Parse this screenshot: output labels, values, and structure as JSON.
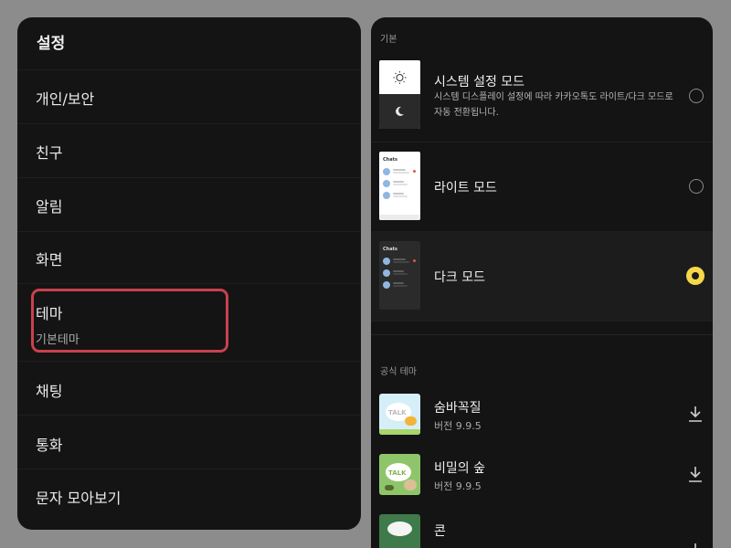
{
  "settings": {
    "title": "설정",
    "items": [
      {
        "label": "개인/보안"
      },
      {
        "label": "친구"
      },
      {
        "label": "알림"
      },
      {
        "label": "화면"
      },
      {
        "label": "테마",
        "sublabel": "기본테마"
      },
      {
        "label": "채팅"
      },
      {
        "label": "통화"
      },
      {
        "label": "문자 모아보기"
      }
    ]
  },
  "theme_page": {
    "basic_section_label": "기본",
    "modes": [
      {
        "title": "시스템 설정 모드",
        "description": "시스템 디스플레이 설정에 따라 카카오톡도 라이트/다크 모드로 자동 전환됩니다.",
        "selected": false
      },
      {
        "title": "라이트 모드",
        "thumb_caption": "Chats",
        "selected": false
      },
      {
        "title": "다크 모드",
        "thumb_caption": "Chats",
        "selected": true
      }
    ],
    "official_section_label": "공식 테마",
    "themes": [
      {
        "title": "숨바꼭질",
        "version": "버전 9.9.5",
        "thumb_text": "TALK",
        "icon": "download-icon"
      },
      {
        "title": "비밀의 숲",
        "version": "버전 9.9.5",
        "thumb_text": "TALK",
        "icon": "download-icon"
      },
      {
        "title": "콘",
        "version": "",
        "icon": "download-icon"
      }
    ]
  },
  "colors": {
    "background": "#8c8c8c",
    "panel": "#141414",
    "highlight": "#c8414d",
    "radio_selected": "#f7d84a"
  }
}
